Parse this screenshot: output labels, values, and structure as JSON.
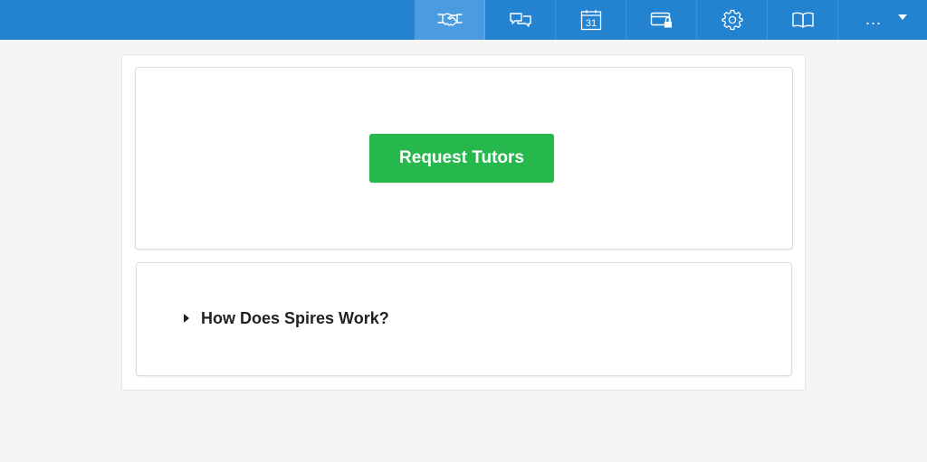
{
  "header": {
    "background": "#2383d1",
    "nav_items": [
      {
        "icon": "handshake-icon",
        "active": true
      },
      {
        "icon": "chat-bubbles-icon",
        "active": false
      },
      {
        "icon": "calendar-icon",
        "label": "31",
        "active": false
      },
      {
        "icon": "payment-card-lock-icon",
        "active": false
      },
      {
        "icon": "gear-icon",
        "active": false
      },
      {
        "icon": "open-book-icon",
        "active": false
      }
    ],
    "more_label": "..."
  },
  "main": {
    "request_button_label": "Request Tutors",
    "request_button_color": "#27b84d",
    "faq_label": "How Does Spires Work?"
  }
}
